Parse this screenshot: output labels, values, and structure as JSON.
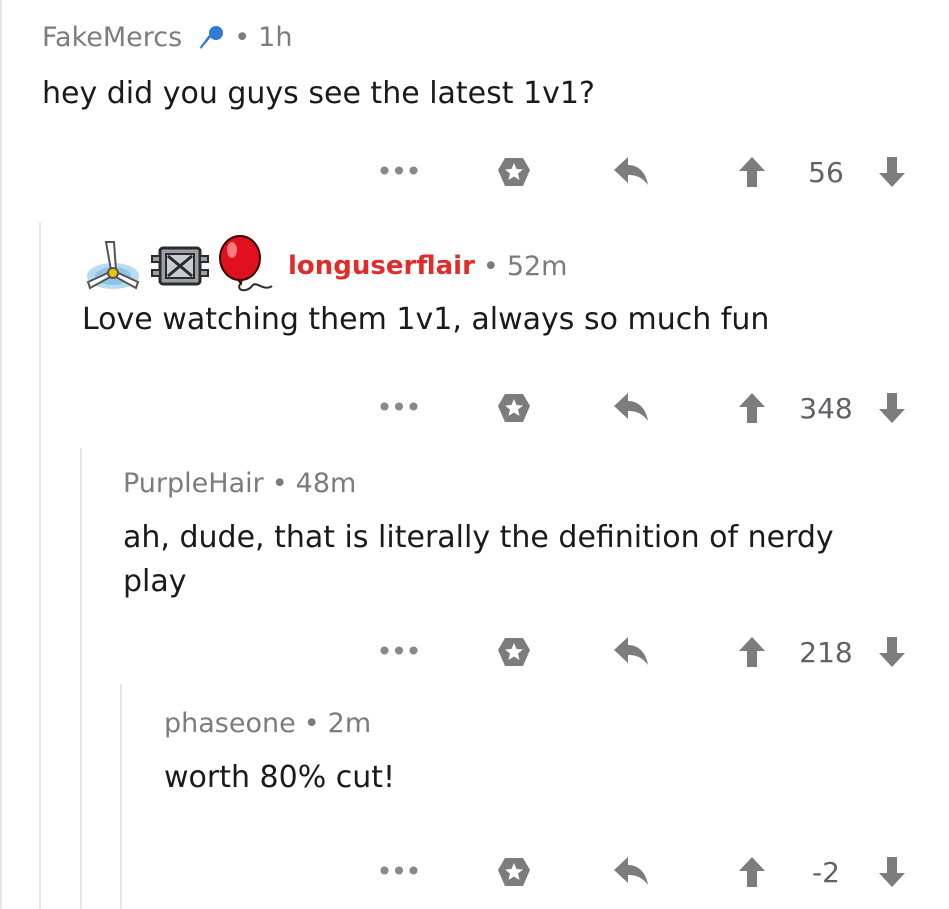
{
  "comments": [
    {
      "username": "FakeMercs",
      "separator": "•",
      "time": "1h",
      "body": "hey did you guys see the latest 1v1?",
      "more": "•••",
      "score": "56"
    },
    {
      "username": "longuserflair",
      "separator": "•",
      "time": "52m",
      "body": "Love watching them 1v1, always so much fun",
      "more": "•••",
      "score": "348"
    },
    {
      "username": "PurpleHair",
      "separator": "•",
      "time": "48m",
      "body": "ah, dude, that is literally the definition of nerdy play",
      "more": "•••",
      "score": "218"
    },
    {
      "username": "phaseone",
      "separator": "•",
      "time": "2m",
      "body": "worth 80% cut!",
      "more": "•••",
      "score": "-2"
    }
  ],
  "colors": {
    "flair_username": "#e22b2b",
    "icon_gray": "#7c7c7c",
    "mic_blue": "#2f7bd6",
    "balloon_red": "#e0101e"
  },
  "icons": {
    "award": "award-star-icon",
    "reply": "reply-arrow-icon",
    "upvote": "upvote-arrow-icon",
    "downvote": "downvote-arrow-icon",
    "mic": "microphone-icon",
    "propeller": "propeller-icon",
    "silver_block": "silver-block-icon",
    "balloon": "balloon-icon"
  }
}
